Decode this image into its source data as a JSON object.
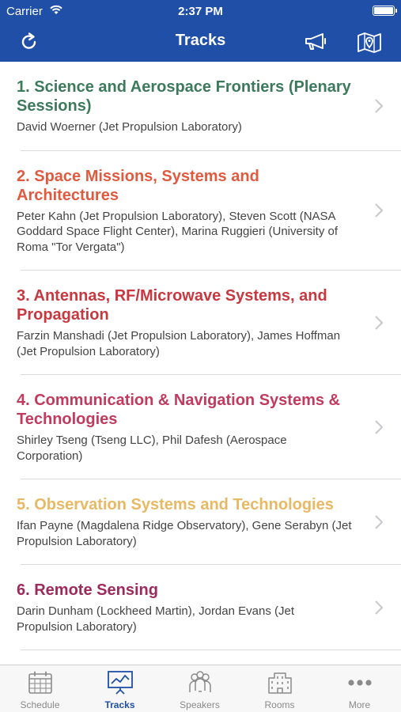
{
  "status": {
    "carrier": "Carrier",
    "time": "2:37 PM"
  },
  "nav": {
    "title": "Tracks"
  },
  "colors": {
    "brand": "#1f4fa6"
  },
  "tracks": [
    {
      "title": "1. Science and Aerospace Frontiers (Plenary Sessions)",
      "chairs": "David Woerner (Jet Propulsion Laboratory)",
      "color": "#3d7a5c"
    },
    {
      "title": "2. Space Missions, Systems and Architectures",
      "chairs": "Peter Kahn (Jet Propulsion Laboratory), Steven Scott (NASA Goddard Space Flight Center), Marina Ruggieri (University of Roma \"Tor Vergata\")",
      "color": "#e05a40"
    },
    {
      "title": "3. Antennas, RF/Microwave Systems, and Propagation",
      "chairs": "Farzin Manshadi (Jet Propulsion Laboratory), James Hoffman (Jet Propulsion Laboratory)",
      "color": "#c8383f"
    },
    {
      "title": "4. Communication &  Navigation Systems & Technologies",
      "chairs": "Shirley Tseng (Tseng LLC), Phil Dafesh (Aerospace Corporation)",
      "color": "#c23a5e"
    },
    {
      "title": "5. Observation Systems and Technologies",
      "chairs": "Ifan Payne (Magdalena Ridge Observatory), Gene Serabyn (Jet Propulsion Laboratory)",
      "color": "#e8b964"
    },
    {
      "title": "6. Remote Sensing",
      "chairs": "Darin Dunham (Lockheed Martin), Jordan Evans (Jet Propulsion Laboratory)",
      "color": "#9c2a5c"
    }
  ],
  "tabs": [
    {
      "label": "Schedule",
      "icon": "calendar-icon",
      "active": false
    },
    {
      "label": "Tracks",
      "icon": "chart-icon",
      "active": true
    },
    {
      "label": "Speakers",
      "icon": "people-icon",
      "active": false
    },
    {
      "label": "Rooms",
      "icon": "building-icon",
      "active": false
    },
    {
      "label": "More",
      "icon": "more-dots-icon",
      "active": false
    }
  ]
}
